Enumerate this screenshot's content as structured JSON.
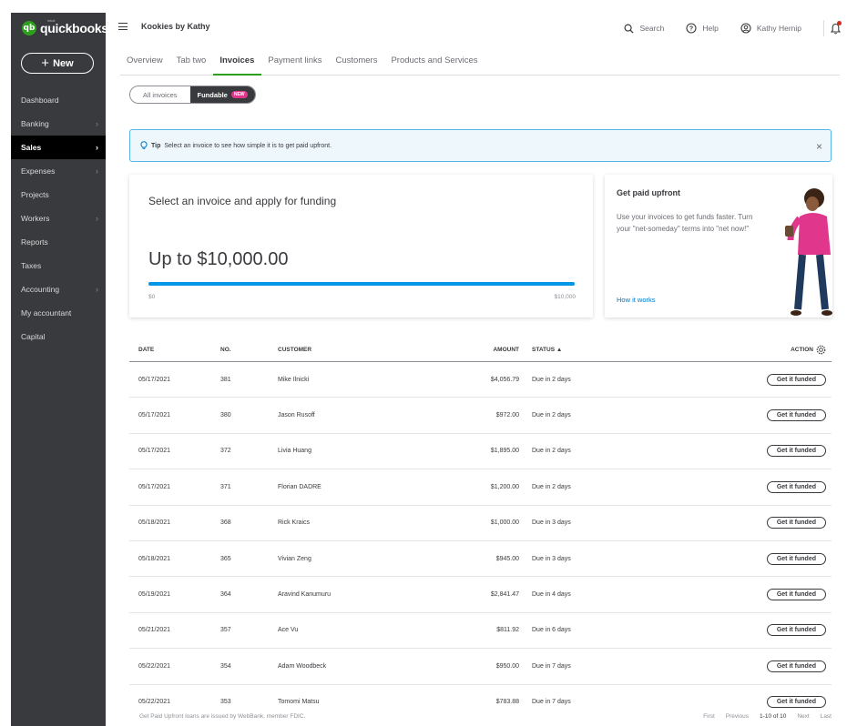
{
  "sidebar": {
    "logo_brand": "intuit",
    "logo_text": "quickbooks",
    "new_label": "New",
    "items": [
      {
        "label": "Dashboard",
        "chev": ""
      },
      {
        "label": "Banking",
        "chev": "›"
      },
      {
        "label": "Sales",
        "chev": "›",
        "active": true
      },
      {
        "label": "Expenses",
        "chev": "›"
      },
      {
        "label": "Projects",
        "chev": ""
      },
      {
        "label": "Workers",
        "chev": "›"
      },
      {
        "label": "Reports",
        "chev": ""
      },
      {
        "label": "Taxes",
        "chev": ""
      },
      {
        "label": "Accounting",
        "chev": "›"
      },
      {
        "label": "My accountant",
        "chev": ""
      },
      {
        "label": "Capital",
        "chev": ""
      }
    ]
  },
  "header": {
    "company": "Kookies by Kathy",
    "search": "Search",
    "help": "Help",
    "user": "Kathy Hernip"
  },
  "tabs": [
    "Overview",
    "Tab two",
    "Invoices",
    "Payment links",
    "Customers",
    "Products and Services"
  ],
  "toggle": {
    "all": "All invoices",
    "fundable": "Fundable",
    "badge": "NEW"
  },
  "tip": {
    "label": "Tip",
    "text": "Select an invoice to see how simple it is to get paid upfront."
  },
  "funding": {
    "title": "Select an invoice and apply for funding",
    "amount": "Up to $10,000.00",
    "min": "$0",
    "max": "$10,000",
    "progress": 1.0
  },
  "upfront": {
    "title": "Get paid upfront",
    "body": "Use your invoices to get funds faster. Turn your \"net-someday\" terms into \"net now!\"",
    "link": "How it works"
  },
  "table": {
    "headers": {
      "date": "DATE",
      "no": "NO.",
      "customer": "CUSTOMER",
      "amount": "AMOUNT",
      "status": "STATUS",
      "sort": "▲",
      "action": "ACTION"
    },
    "rows": [
      {
        "date": "05/17/2021",
        "no": "381",
        "customer": "Mike Ilnicki",
        "amount": "$4,056.79",
        "status": "Due in 2 days",
        "action": "Get it funded"
      },
      {
        "date": "05/17/2021",
        "no": "380",
        "customer": "Jason Rusoff",
        "amount": "$972.00",
        "status": "Due in 2 days",
        "action": "Get it funded"
      },
      {
        "date": "05/17/2021",
        "no": "372",
        "customer": "Livia Huang",
        "amount": "$1,895.00",
        "status": "Due in 2 days",
        "action": "Get it funded"
      },
      {
        "date": "05/17/2021",
        "no": "371",
        "customer": "Florian DADRE",
        "amount": "$1,200.00",
        "status": "Due in 2 days",
        "action": "Get it funded"
      },
      {
        "date": "05/18/2021",
        "no": "368",
        "customer": "Rick Kraics",
        "amount": "$1,000.00",
        "status": "Due in 3 days",
        "action": "Get it funded"
      },
      {
        "date": "05/18/2021",
        "no": "365",
        "customer": "Vivian Zeng",
        "amount": "$945.00",
        "status": "Due in 3 days",
        "action": "Get it funded"
      },
      {
        "date": "05/19/2021",
        "no": "364",
        "customer": "Aravind Kanumuru",
        "amount": "$2,841.47",
        "status": "Due in 4 days",
        "action": "Get it funded"
      },
      {
        "date": "05/21/2021",
        "no": "357",
        "customer": "Ace Vu",
        "amount": "$811.92",
        "status": "Due in 6 days",
        "action": "Get it funded"
      },
      {
        "date": "05/22/2021",
        "no": "354",
        "customer": "Adam Woodbeck",
        "amount": "$950.00",
        "status": "Due in 7 days",
        "action": "Get it funded"
      },
      {
        "date": "05/22/2021",
        "no": "353",
        "customer": "Tomomi Matsu",
        "amount": "$783.88",
        "status": "Due in 7 days",
        "action": "Get it funded"
      }
    ]
  },
  "footer": {
    "note": "Get Paid Upfront loans are issued by WebBank, member FDIC.",
    "first": "First",
    "previous": "Previous",
    "range": "1-10 of 10",
    "next": "Next",
    "last": "Last"
  }
}
